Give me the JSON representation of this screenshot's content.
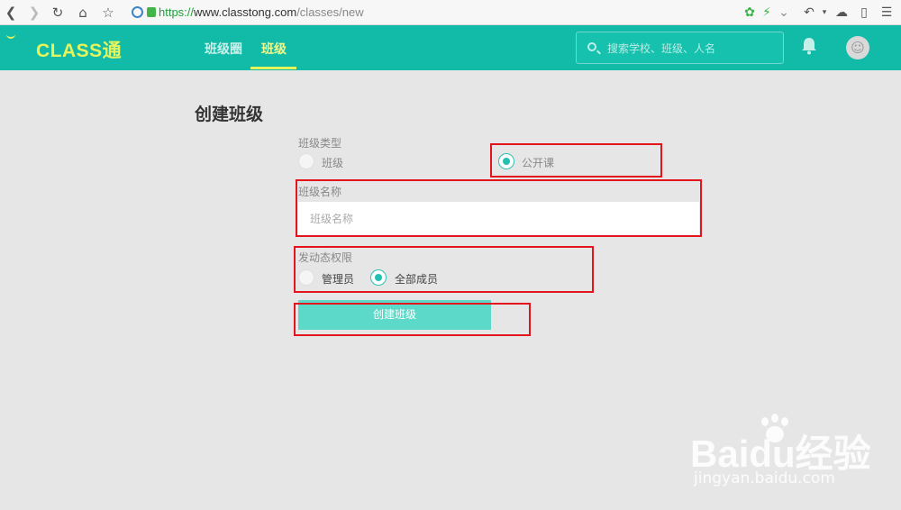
{
  "browser": {
    "url_scheme": "https://",
    "url_host": "www.classtong.com",
    "url_path": "/classes/new"
  },
  "header": {
    "brand": "CLASS通",
    "tabs": [
      {
        "label": "班级圈",
        "active": false
      },
      {
        "label": "班级",
        "active": true
      }
    ],
    "search_placeholder": "搜索学校、班级、人名",
    "accent_color": "#11bba8",
    "brand_color": "#e6f45b"
  },
  "form": {
    "title": "创建班级",
    "type_label": "班级类型",
    "type_options": [
      {
        "label": "班级",
        "checked": false
      },
      {
        "label": "公开课",
        "checked": true
      }
    ],
    "name_label": "班级名称",
    "name_placeholder": "班级名称",
    "name_value": "",
    "permission_label": "发动态权限",
    "permission_options": [
      {
        "label": "管理员",
        "checked": false
      },
      {
        "label": "全部成员",
        "checked": true
      }
    ],
    "submit_label": "创建班级"
  },
  "watermark": {
    "main": "Baidu经验",
    "sub": "jingyan.baidu.com"
  }
}
